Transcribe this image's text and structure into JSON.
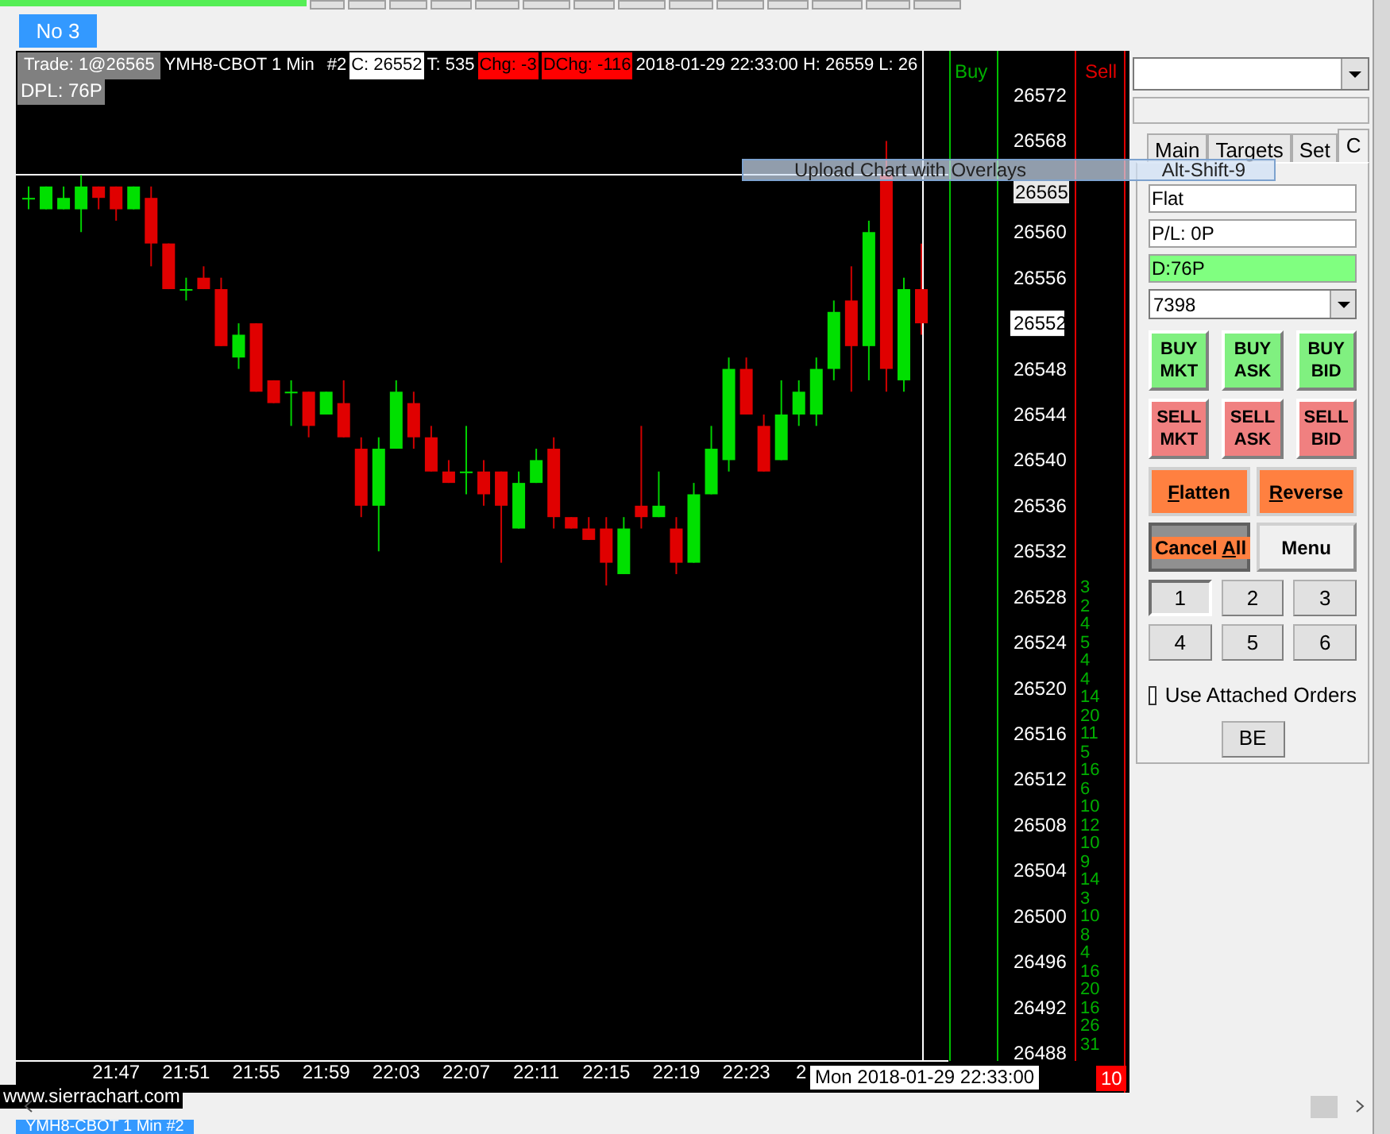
{
  "chartbook_tab": {
    "label": "No 3",
    "selected": true
  },
  "header": {
    "trade": "Trade: 1@26565",
    "symbol": "YMH8-CBOT  1 Min",
    "chart_number": "#2",
    "close": "C: 26552",
    "ticks": "T: 535",
    "change": "Chg: -3",
    "daily_change": "DChg: -116",
    "info": "2018-01-29 22:33:00  H: 26559  L: 26",
    "dpl": "DPL: 76P"
  },
  "columns": {
    "buy": "Buy",
    "sell": "Sell"
  },
  "chart_data": {
    "type": "candlestick",
    "categories": [
      null,
      null,
      null,
      null,
      null,
      "21:47",
      null,
      null,
      null,
      "21:51",
      null,
      null,
      null,
      "21:55",
      null,
      null,
      null,
      "21:59",
      null,
      null,
      null,
      "22:03",
      null,
      null,
      null,
      "22:07",
      null,
      null,
      null,
      "22:11",
      null,
      null,
      null,
      "22:15",
      null,
      null,
      null,
      "22:19",
      null,
      null,
      null,
      "22:23",
      null,
      null,
      null,
      null,
      null,
      null,
      null,
      null,
      null,
      null
    ],
    "ylim": [
      26487.3,
      26575.9
    ],
    "yticks": [
      26572,
      26568,
      26560,
      26556,
      26552,
      26548,
      26544,
      26540,
      26536,
      26532,
      26528,
      26524,
      26520,
      26516,
      26512,
      26508,
      26504,
      26500,
      26496,
      26492,
      26488
    ],
    "ohlc": [
      [
        26563,
        26564,
        26562,
        26563
      ],
      [
        26562,
        26564,
        26562,
        26564
      ],
      [
        26562,
        26564,
        26562,
        26563
      ],
      [
        26562,
        26565,
        26560,
        26564
      ],
      [
        26564,
        26564,
        26562,
        26563
      ],
      [
        26564,
        26564,
        26561,
        26562
      ],
      [
        26562,
        26564,
        26562,
        26564
      ],
      [
        26563,
        26564,
        26557,
        26559
      ],
      [
        26559,
        26559,
        26555,
        26555
      ],
      [
        26555,
        26556,
        26554,
        26555
      ],
      [
        26556,
        26557,
        26555,
        26555
      ],
      [
        26555,
        26556,
        26550,
        26550
      ],
      [
        26549,
        26552,
        26548,
        26551
      ],
      [
        26552,
        26552,
        26546,
        26546
      ],
      [
        26547,
        26547,
        26545,
        26545
      ],
      [
        26546,
        26547,
        26543,
        26546
      ],
      [
        26546,
        26546,
        26542,
        26543
      ],
      [
        26544,
        26546,
        26544,
        26546
      ],
      [
        26545,
        26547,
        26542,
        26542
      ],
      [
        26541,
        26542,
        26535,
        26536
      ],
      [
        26536,
        26542,
        26532,
        26541
      ],
      [
        26541,
        26547,
        26541,
        26546
      ],
      [
        26545,
        26546,
        26541,
        26542
      ],
      [
        26542,
        26543,
        26539,
        26539
      ],
      [
        26539,
        26540,
        26538,
        26538
      ],
      [
        26539,
        26543,
        26537,
        26539
      ],
      [
        26539,
        26540,
        26536,
        26537
      ],
      [
        26539,
        26539,
        26531,
        26536
      ],
      [
        26534,
        26539,
        26534,
        26538
      ],
      [
        26538,
        26541,
        26538,
        26540
      ],
      [
        26541,
        26542,
        26534,
        26535
      ],
      [
        26535,
        26535,
        26534,
        26534
      ],
      [
        26534,
        26535,
        26533,
        26533
      ],
      [
        26534,
        26535,
        26529,
        26531
      ],
      [
        26530,
        26535,
        26530,
        26534
      ],
      [
        26536,
        26543,
        26534,
        26535
      ],
      [
        26535,
        26539,
        26535,
        26536
      ],
      [
        26534,
        26535,
        26530,
        26531
      ],
      [
        26531,
        26538,
        26531,
        26537
      ],
      [
        26537,
        26543,
        26537,
        26541
      ],
      [
        26540,
        26549,
        26539,
        26548
      ],
      [
        26548,
        26549,
        26544,
        26544
      ],
      [
        26543,
        26544,
        26539,
        26539
      ],
      [
        26540,
        26547,
        26540,
        26544
      ],
      [
        26544,
        26547,
        26543,
        26546
      ],
      [
        26544,
        26549,
        26543,
        26548
      ],
      [
        26548,
        26554,
        26547,
        26553
      ],
      [
        26554,
        26557,
        26546,
        26550
      ],
      [
        26550,
        26561,
        26547,
        26560
      ],
      [
        26565,
        26568,
        26546,
        26548
      ],
      [
        26547,
        26556,
        26546,
        26555
      ],
      [
        26555,
        26559,
        26551,
        26552
      ]
    ]
  },
  "trade_price": "26565",
  "volume_numbers": [
    "3",
    "2",
    "4",
    "5",
    "4",
    "4",
    "14",
    "20",
    "11",
    "5",
    "16",
    "6",
    "10",
    "12",
    "10",
    "9",
    "14",
    "3",
    "10",
    "8",
    "4",
    "16",
    "20",
    "16",
    "26",
    "31"
  ],
  "time_axis_cut": "2",
  "cursor_time": "Mon 2018-01-29  22:33:00",
  "bar_count": "10",
  "website": "www.sierrachart.com",
  "context_menu": {
    "label": "Upload Chart with Overlays",
    "shortcut": "Alt-Shift-9"
  },
  "trade_panel": {
    "tabs": [
      {
        "label": "Main",
        "selected": false
      },
      {
        "label": "Targets",
        "selected": false
      },
      {
        "label": "Set",
        "selected": false
      },
      {
        "label": "C",
        "selected": true
      }
    ],
    "position": "Flat",
    "pl": "P/L: 0P",
    "daily": "D:76P",
    "quantity": "7398",
    "order_buttons": [
      {
        "label": "BUY MKT",
        "kind": "buy"
      },
      {
        "label": "BUY ASK",
        "kind": "buy"
      },
      {
        "label": "BUY BID",
        "kind": "buy"
      },
      {
        "label": "SELL MKT",
        "kind": "sell"
      },
      {
        "label": "SELL ASK",
        "kind": "sell"
      },
      {
        "label": "SELL BID",
        "kind": "sell"
      }
    ],
    "action_buttons": [
      {
        "label": "**F**latten",
        "kind": "orange"
      },
      {
        "label": "**R**everse",
        "kind": "orange"
      },
      {
        "label": "Cancel **A**ll",
        "kind": "cancel"
      },
      {
        "label": "Menu",
        "kind": "plain"
      }
    ],
    "number_buttons": [
      {
        "label": "1",
        "selected": true
      },
      {
        "label": "2",
        "selected": false
      },
      {
        "label": "3",
        "selected": false
      },
      {
        "label": "4",
        "selected": false
      },
      {
        "label": "5",
        "selected": false
      },
      {
        "label": "6",
        "selected": false
      }
    ],
    "attached_orders": {
      "label": "Use Attached Orders",
      "checked": false
    },
    "be_button": "BE"
  },
  "bottom_tabs": [
    {
      "label": "YMH8-CBOT 1 Min #2",
      "selected": true
    }
  ]
}
